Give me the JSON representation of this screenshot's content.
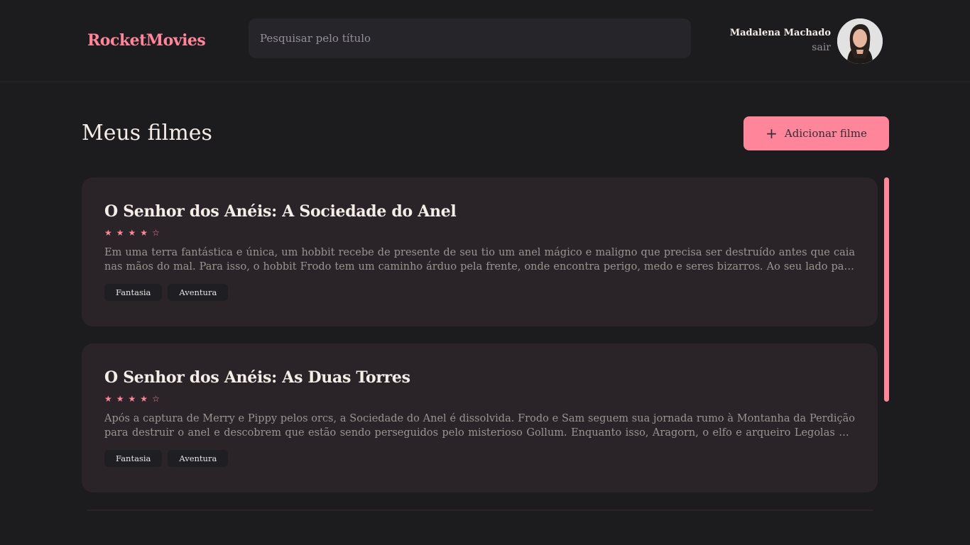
{
  "header": {
    "logo": "RocketMovies",
    "search_placeholder": "Pesquisar pelo título",
    "profile": {
      "name": "Madalena Machado",
      "logout_label": "sair"
    }
  },
  "main": {
    "title": "Meus filmes",
    "add_button_label": "Adicionar filme",
    "movies": [
      {
        "title": "O Senhor dos Anéis: A Sociedade do Anel",
        "rating": 4,
        "max_rating": 5,
        "description": "Em uma terra fantástica e única, um hobbit recebe de presente de seu tio um anel mágico e maligno que precisa ser destruído antes que caia nas mãos do mal. Para isso, o hobbit Frodo tem um caminho árduo pela frente, onde encontra perigo, medo e seres bizarros. Ao seu lado para o cumprimento desta jornada.",
        "tags": [
          "Fantasia",
          "Aventura"
        ]
      },
      {
        "title": "O Senhor dos Anéis: As Duas Torres",
        "rating": 4,
        "max_rating": 5,
        "description": "Após a captura de Merry e Pippy pelos orcs, a Sociedade do Anel é dissolvida. Frodo e Sam seguem sua jornada rumo à Montanha da Perdição para destruir o anel e descobrem que estão sendo perseguidos pelo misterioso Gollum. Enquanto isso, Aragorn, o elfo e arqueiro Legolas e o anão Gimli partem.",
        "tags": [
          "Fantasia",
          "Aventura"
        ]
      }
    ]
  },
  "colors": {
    "accent": "#ff859b",
    "background": "#1c1b1e",
    "card": "#2a2328"
  }
}
